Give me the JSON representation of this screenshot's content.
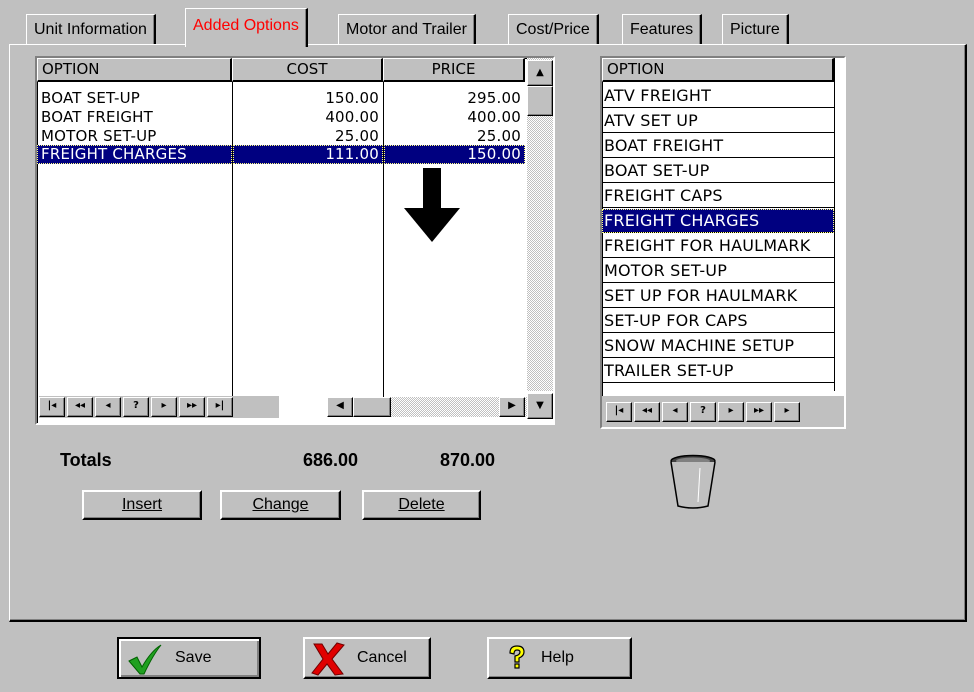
{
  "tabs": [
    {
      "label": "Unit Information"
    },
    {
      "label": "Added Options",
      "active": true
    },
    {
      "label": "Motor and Trailer"
    },
    {
      "label": "Cost/Price"
    },
    {
      "label": "Features"
    },
    {
      "label": "Picture"
    }
  ],
  "options_grid": {
    "headers": {
      "option": "OPTION",
      "cost": "COST",
      "price": "PRICE"
    },
    "rows": [
      {
        "option": "BOAT SET-UP",
        "cost": "150.00",
        "price": "295.00"
      },
      {
        "option": "BOAT FREIGHT",
        "cost": "400.00",
        "price": "400.00"
      },
      {
        "option": "MOTOR SET-UP",
        "cost": "25.00",
        "price": "25.00"
      },
      {
        "option": "FREIGHT CHARGES",
        "cost": "111.00",
        "price": "150.00",
        "selected": true
      }
    ],
    "navigator": [
      "|◂",
      "◂◂",
      "◂",
      "?",
      "▸",
      "▸▸",
      "▸|"
    ]
  },
  "available_list": {
    "header": "OPTION",
    "items": [
      "ATV FREIGHT",
      "ATV SET UP",
      "BOAT FREIGHT",
      "BOAT SET-UP",
      "FREIGHT CAPS",
      "FREIGHT CHARGES",
      "FREIGHT FOR HAULMARK",
      "MOTOR SET-UP",
      "SET UP FOR HAULMARK",
      "SET-UP FOR CAPS",
      "SNOW MACHINE SETUP",
      "TRAILER SET-UP"
    ],
    "selected_index": 5,
    "navigator": [
      "|◂",
      "◂◂",
      "◂",
      "?",
      "▸",
      "▸▸",
      "▸"
    ]
  },
  "totals": {
    "label": "Totals",
    "cost": "686.00",
    "price": "870.00"
  },
  "grid_buttons": {
    "insert": "Insert",
    "change": "Change",
    "delete": "Delete"
  },
  "footer_buttons": {
    "save": "Save",
    "cancel": "Cancel",
    "help": "Help"
  },
  "icons": [
    "down-arrow-icon",
    "trash-can-icon",
    "checkmark-icon",
    "red-x-icon",
    "question-mark-icon"
  ]
}
